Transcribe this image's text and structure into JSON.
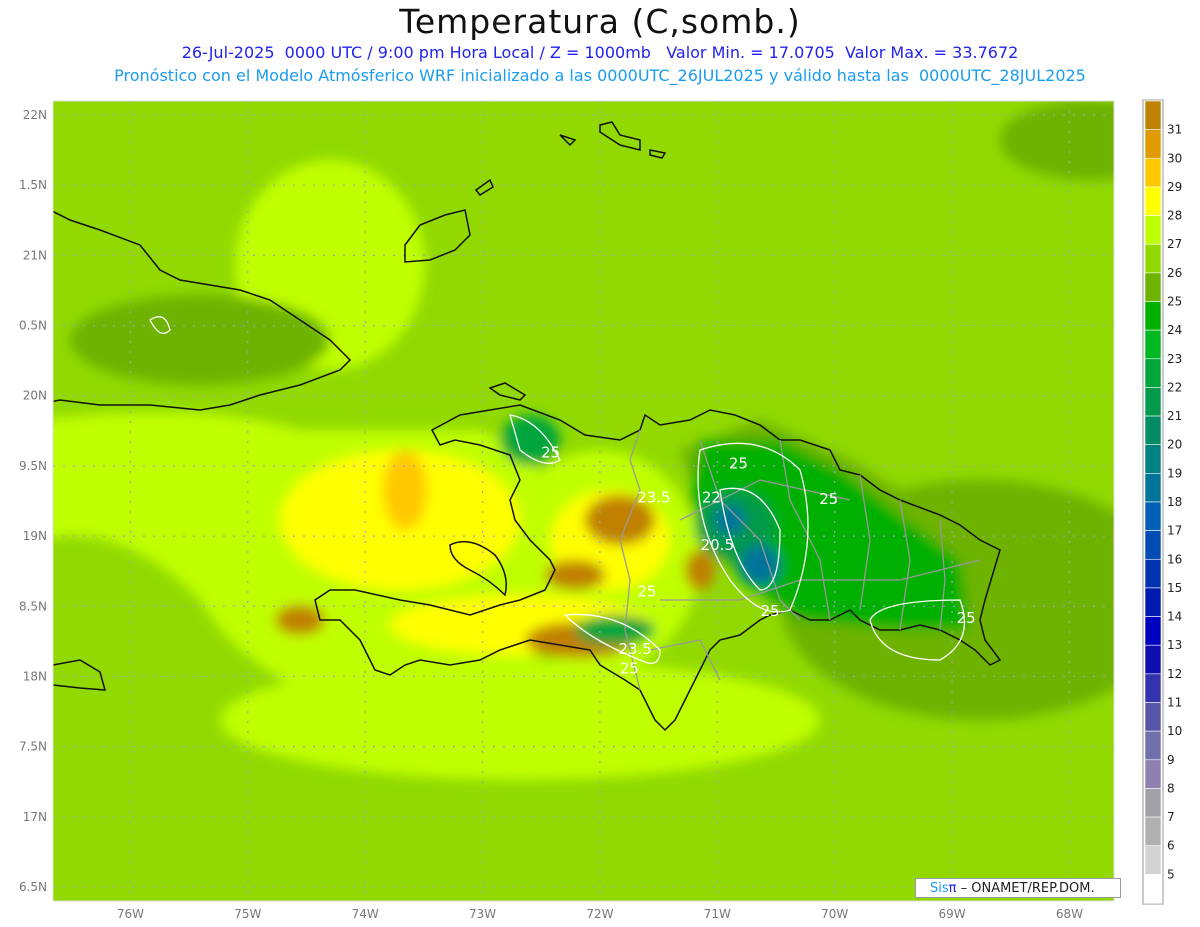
{
  "header": {
    "title": "Temperatura (C,somb.)",
    "subtitle_line1": "26-Jul-2025  0000 UTC / 9:00 pm Hora Local / Z = 1000mb   Valor Min. = 17.0705  Valor Max. = 33.7672",
    "subtitle_line2": "Pronóstico con el Modelo Atmósferico WRF inicializado a las 0000UTC_26JUL2025 y válido hasta las  0000UTC_28JUL2025"
  },
  "map": {
    "variable": "Temperatura",
    "units": "C",
    "level": "1000mb",
    "value_min": 17.0705,
    "value_max": 33.7672,
    "lon_labels": [
      "76W",
      "75W",
      "74W",
      "73W",
      "72W",
      "71W",
      "70W",
      "69W",
      "68W"
    ],
    "lon_values": [
      -76,
      -75,
      -74,
      -73,
      -72,
      -71,
      -70,
      -69,
      -68
    ],
    "lat_labels": [
      "22N",
      "1.5N",
      "21N",
      "0.5N",
      "20N",
      "9.5N",
      "19N",
      "8.5N",
      "18N",
      "7.5N",
      "17N",
      "6.5N"
    ],
    "lat_values": [
      22,
      21.5,
      21,
      20.5,
      20,
      19.5,
      19,
      18.5,
      18,
      17.5,
      17,
      16.5
    ],
    "lon_range": [
      -76.66,
      -67.62
    ],
    "lat_range": [
      16.4,
      22.1
    ],
    "contour_labels": [
      {
        "text": "25",
        "lon": -72.42,
        "lat": 19.56
      },
      {
        "text": "25",
        "lon": -70.82,
        "lat": 19.48
      },
      {
        "text": "23.5",
        "lon": -71.54,
        "lat": 19.24
      },
      {
        "text": "22",
        "lon": -71.05,
        "lat": 19.24
      },
      {
        "text": "25",
        "lon": -70.05,
        "lat": 19.23
      },
      {
        "text": "20.5",
        "lon": -71.0,
        "lat": 18.9
      },
      {
        "text": "25",
        "lon": -71.6,
        "lat": 18.57
      },
      {
        "text": "25",
        "lon": -70.55,
        "lat": 18.43
      },
      {
        "text": "25",
        "lon": -68.88,
        "lat": 18.38
      },
      {
        "text": "23.5",
        "lon": -71.7,
        "lat": 18.16
      },
      {
        "text": "25",
        "lon": -71.75,
        "lat": 18.02
      }
    ]
  },
  "colorbar": {
    "labels": [
      "31",
      "30",
      "29",
      "28",
      "27",
      "26",
      "25",
      "24",
      "23",
      "22",
      "21",
      "20",
      "19",
      "18",
      "17",
      "16",
      "15",
      "14",
      "13",
      "12",
      "11",
      "10",
      "9",
      "8",
      "7",
      "6",
      "5"
    ],
    "colors": [
      "#c08000",
      "#e09b00",
      "#ffc800",
      "#ffff00",
      "#bfff00",
      "#91d900",
      "#6db300",
      "#00b000",
      "#00b822",
      "#00a53c",
      "#009a4a",
      "#008c64",
      "#008080",
      "#00739b",
      "#005fb4",
      "#004cb4",
      "#0033b0",
      "#001ab0",
      "#0000c0",
      "#0d0db0",
      "#3333b0",
      "#5555aa",
      "#7070aa",
      "#9080b0",
      "#a0a0a8",
      "#b0b0b0",
      "#d3d3d3",
      "#ffffff"
    ]
  },
  "credit": {
    "sis": "Sis",
    "pi": "π",
    "rest": " – ONAMET/REP.DOM."
  }
}
